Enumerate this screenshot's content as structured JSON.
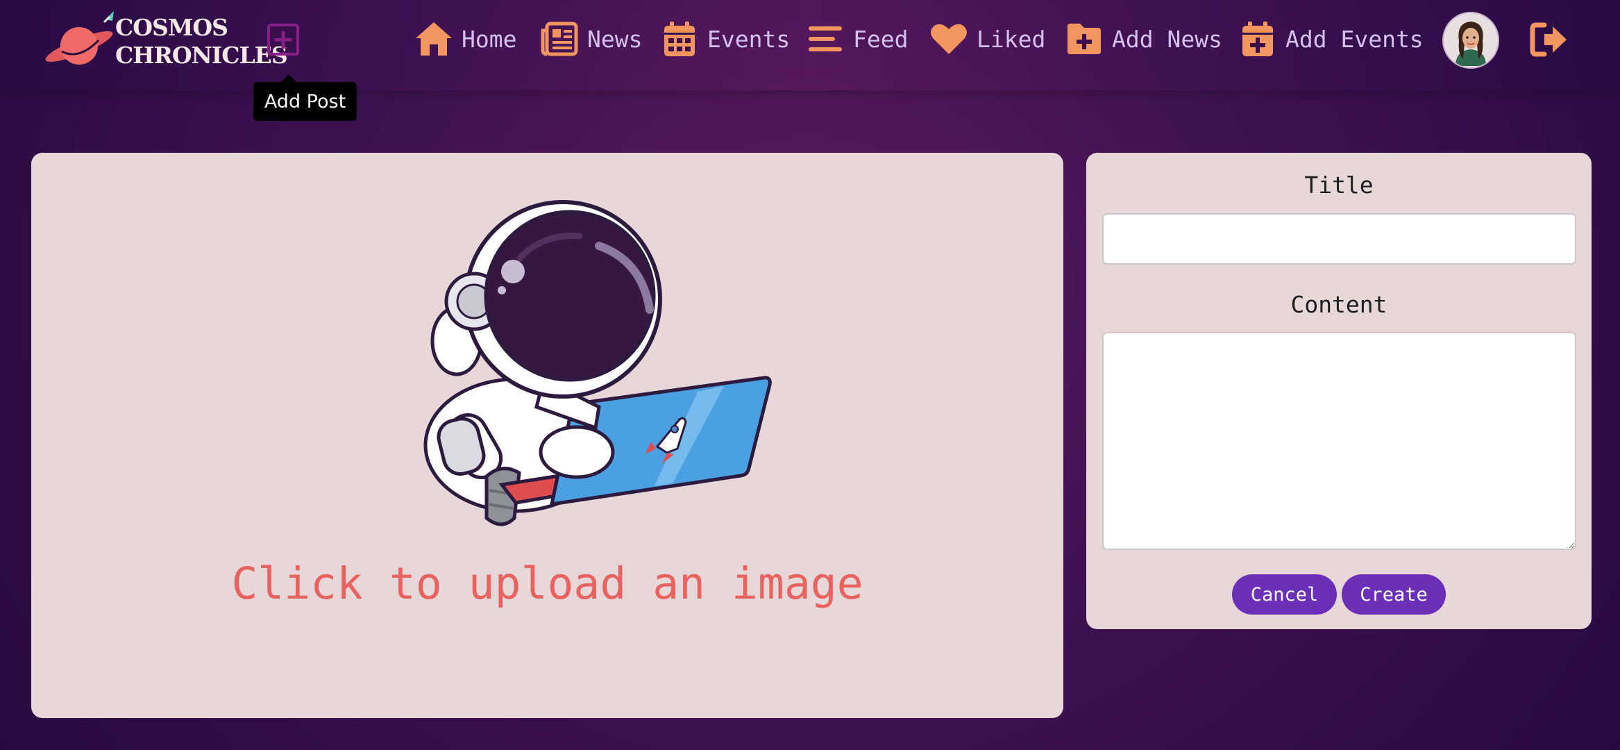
{
  "brand": {
    "line1": "COSMOS",
    "line2": "CHRONICLES"
  },
  "add_post": {
    "icon": "plus-square-icon",
    "tooltip": "Add Post"
  },
  "nav": [
    {
      "label": "Home",
      "icon": "home-icon"
    },
    {
      "label": "News",
      "icon": "newspaper-icon"
    },
    {
      "label": "Events",
      "icon": "calendar-icon"
    },
    {
      "label": "Feed",
      "icon": "lines-icon"
    },
    {
      "label": "Liked",
      "icon": "heart-icon"
    },
    {
      "label": "Add News",
      "icon": "folder-plus-icon"
    },
    {
      "label": "Add Events",
      "icon": "calendar-plus-icon"
    }
  ],
  "upload": {
    "label": "Click to upload an image",
    "illustration": "astronaut-laptop-illustration"
  },
  "form": {
    "title_label": "Title",
    "title_value": "",
    "content_label": "Content",
    "content_value": "",
    "cancel_label": "Cancel",
    "create_label": "Create"
  },
  "colors": {
    "accent": "#f2955f",
    "nav_text": "#d4c2ee",
    "panel": "#e7d7d9",
    "button": "#6b2fb8",
    "upload_text": "#e8625f"
  }
}
